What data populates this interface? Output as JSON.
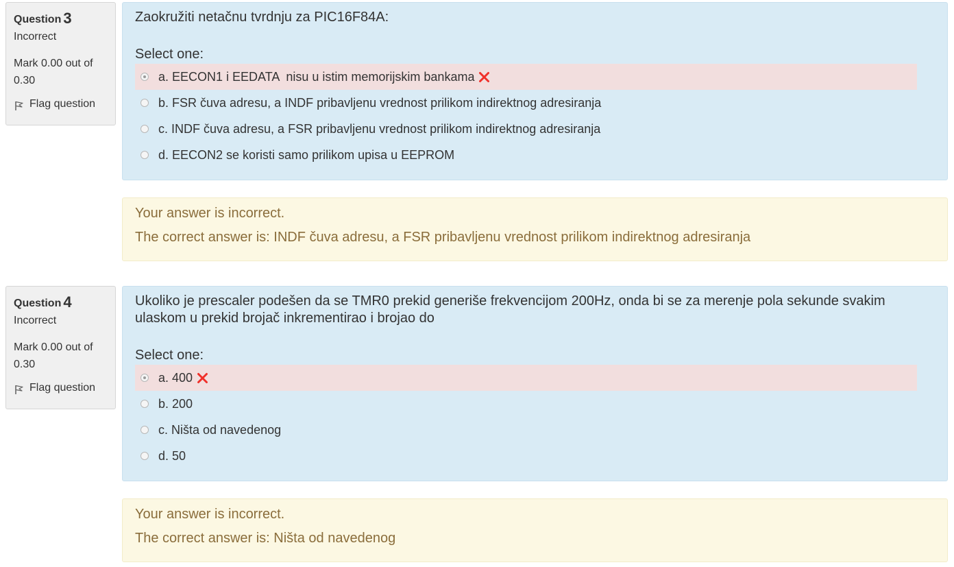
{
  "questions": [
    {
      "label": "Question",
      "number": "3",
      "state": "Incorrect",
      "grade": "Mark 0.00 out of 0.30",
      "flag_label": "Flag question",
      "text": "Zaokružiti netačnu tvrdnju za PIC16F84A:",
      "prompt": "Select one:",
      "answers": [
        {
          "label": "a. EECON1 i EEDATA  nisu u istim memorijskim bankama",
          "selected": true,
          "incorrect": true
        },
        {
          "label": "b. FSR čuva adresu, a INDF pribavljenu vrednost prilikom indirektnog adresiranja",
          "selected": false,
          "incorrect": false
        },
        {
          "label": "c. INDF čuva adresu, a FSR pribavljenu vrednost prilikom indirektnog adresiranja",
          "selected": false,
          "incorrect": false
        },
        {
          "label": "d. EECON2 se koristi samo prilikom upisa u EEPROM",
          "selected": false,
          "incorrect": false
        }
      ],
      "feedback": "Your answer is incorrect.",
      "right_answer": "The correct answer is: INDF čuva adresu, a FSR pribavljenu vrednost prilikom indirektnog adresiranja"
    },
    {
      "label": "Question",
      "number": "4",
      "state": "Incorrect",
      "grade": "Mark 0.00 out of 0.30",
      "flag_label": "Flag question",
      "text": "Ukoliko je prescaler podešen da se TMR0 prekid generiše frekvencijom 200Hz, onda bi se za merenje pola sekunde svakim ulaskom u prekid brojač inkrementirao i brojao do",
      "prompt": "Select one:",
      "answers": [
        {
          "label": "a. 400",
          "selected": true,
          "incorrect": true
        },
        {
          "label": "b. 200",
          "selected": false,
          "incorrect": false
        },
        {
          "label": "c. Ništa od navedenog",
          "selected": false,
          "incorrect": false
        },
        {
          "label": "d. 50",
          "selected": false,
          "incorrect": false
        }
      ],
      "feedback": "Your answer is incorrect.",
      "right_answer": "The correct answer is: Ništa od navedenog"
    }
  ],
  "colors": {
    "formulation_bg": "#d9ebf5",
    "incorrect_bg": "#f2dede",
    "outcome_bg": "#fcf8e3",
    "outcome_text": "#8a6d3b",
    "incorrect_icon": "#f0302a"
  },
  "icons": {
    "flag": "flag-icon",
    "incorrect": "incorrect-x-icon"
  }
}
